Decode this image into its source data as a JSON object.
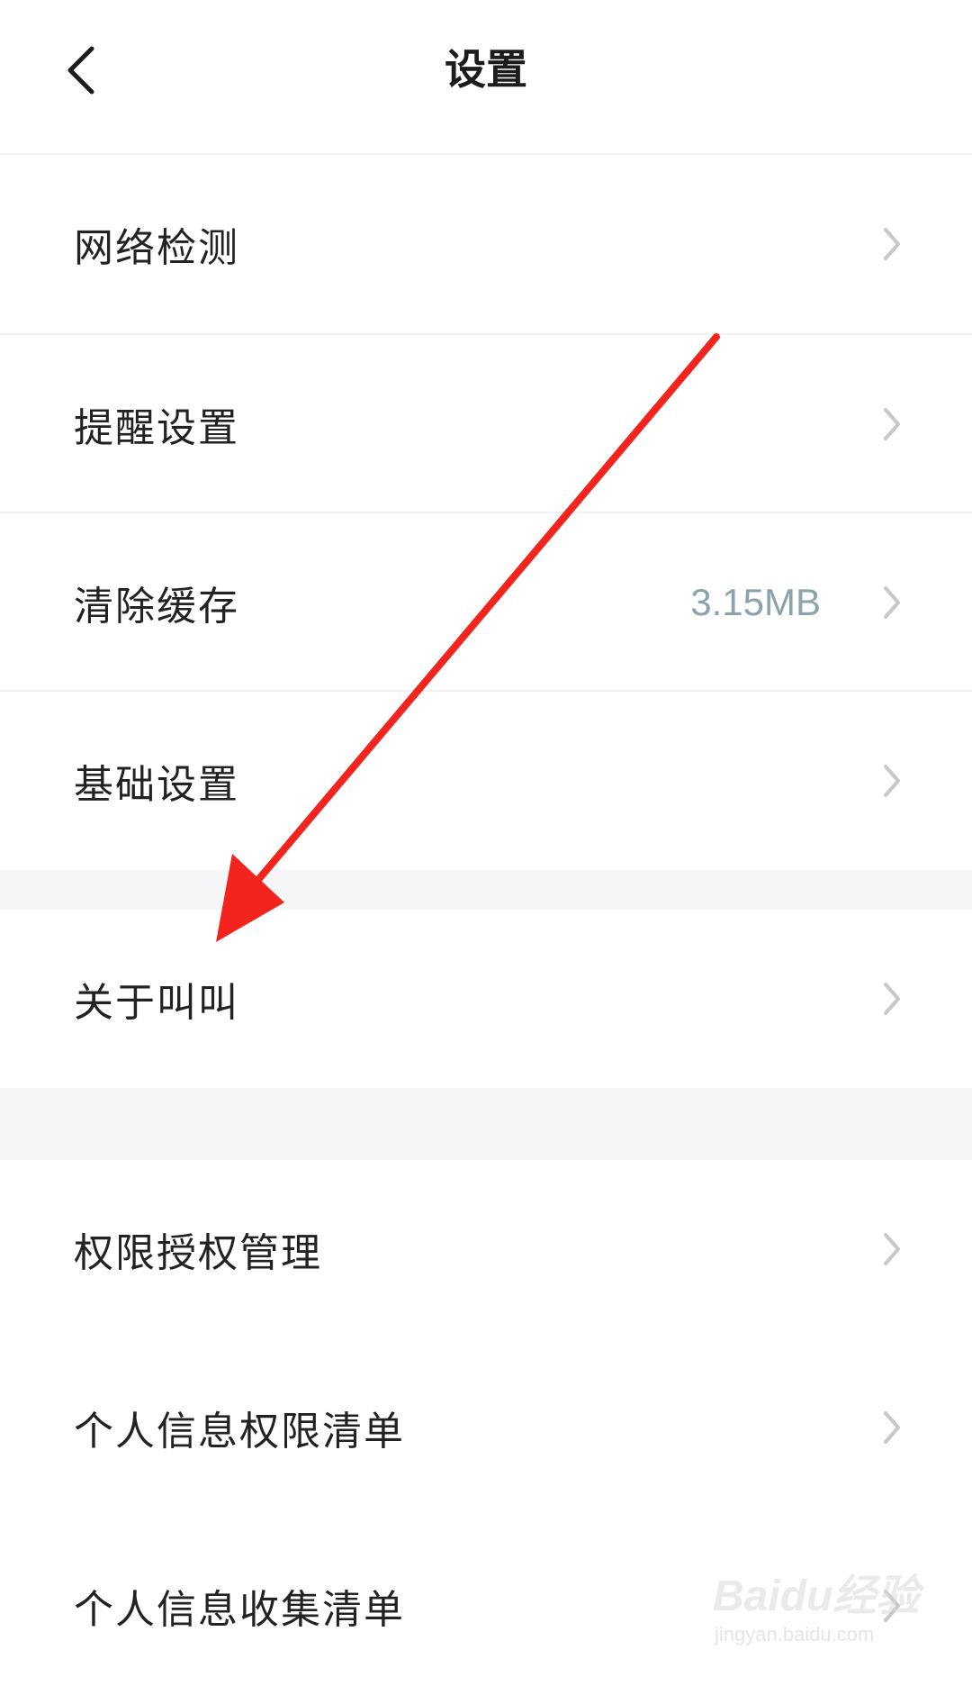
{
  "header": {
    "title": "设置",
    "back_icon": "chevron-left-icon"
  },
  "sections": [
    {
      "items": [
        {
          "label": "网络检测",
          "value": "",
          "icon": "chevron-right-icon"
        },
        {
          "label": "提醒设置",
          "value": "",
          "icon": "chevron-right-icon"
        },
        {
          "label": "清除缓存",
          "value": "3.15MB",
          "icon": "chevron-right-icon"
        },
        {
          "label": "基础设置",
          "value": "",
          "icon": "chevron-right-icon"
        }
      ]
    },
    {
      "items": [
        {
          "label": "关于叫叫",
          "value": "",
          "icon": "chevron-right-icon"
        }
      ]
    },
    {
      "items": [
        {
          "label": "权限授权管理",
          "value": "",
          "icon": "chevron-right-icon"
        },
        {
          "label": "个人信息权限清单",
          "value": "",
          "icon": "chevron-right-icon"
        },
        {
          "label": "个人信息收集清单",
          "value": "",
          "icon": "chevron-right-icon"
        }
      ]
    }
  ],
  "colors": {
    "value_text": "#8ba3ab",
    "annotation_arrow": "#f2241d",
    "section_gap": "#f6f6f8"
  },
  "watermark": {
    "text": "Baidu经验",
    "sub": "jingyan.baidu.com"
  }
}
